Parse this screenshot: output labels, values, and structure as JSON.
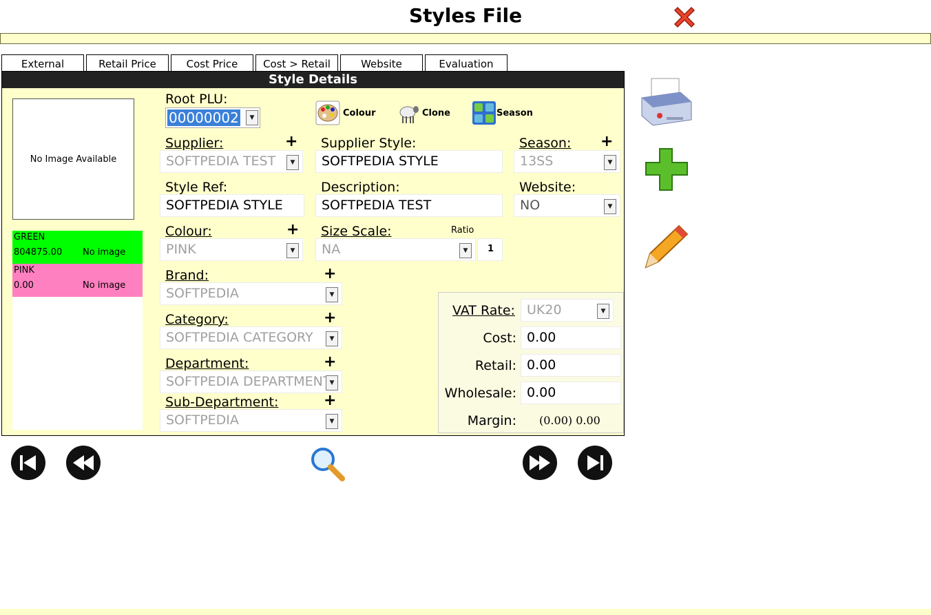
{
  "header": {
    "title": "Styles File"
  },
  "tabs": [
    {
      "label": "External"
    },
    {
      "label": "Retail Price"
    },
    {
      "label": "Cost Price"
    },
    {
      "label": "Cost > Retail"
    },
    {
      "label": "Website"
    },
    {
      "label": "Evaluation"
    }
  ],
  "panel": {
    "title": "Style Details"
  },
  "image_placeholder": "No Image Available",
  "colours": [
    {
      "name": "GREEN",
      "value": "804875.00",
      "image": "No image",
      "color": "#00ff00"
    },
    {
      "name": "PINK",
      "value": "0.00",
      "image": "No image",
      "color": "#ff80c0"
    }
  ],
  "root_plu": {
    "label": "Root PLU:",
    "value": "00000002"
  },
  "toolbar": {
    "colour_label": "Colour",
    "clone_label": "Clone",
    "season_label": "Season"
  },
  "form": {
    "supplier": {
      "label": "Supplier:",
      "value": "SOFTPEDIA TEST"
    },
    "supplier_style": {
      "label": "Supplier Style:",
      "value": "SOFTPEDIA STYLE"
    },
    "season": {
      "label": "Season:",
      "value": "13SS"
    },
    "style_ref": {
      "label": "Style Ref:",
      "value": "SOFTPEDIA STYLE"
    },
    "description": {
      "label": "Description:",
      "value": "SOFTPEDIA TEST"
    },
    "website": {
      "label": "Website:",
      "value": "NO"
    },
    "colour": {
      "label": "Colour:",
      "value": "PINK"
    },
    "size_scale": {
      "label": "Size Scale:",
      "value": "NA",
      "ratio_label": "Ratio",
      "ratio_value": "1"
    },
    "brand": {
      "label": "Brand:",
      "value": "SOFTPEDIA"
    },
    "category": {
      "label": "Category:",
      "value": "SOFTPEDIA CATEGORY"
    },
    "department": {
      "label": "Department:",
      "value": "SOFTPEDIA DEPARTMENT"
    },
    "sub_department": {
      "label": "Sub-Department:",
      "value": "SOFTPEDIA"
    }
  },
  "pricing": {
    "vat_label": "VAT Rate:",
    "vat_value": "UK20",
    "cost_label": "Cost:",
    "cost_value": "0.00",
    "retail_label": "Retail:",
    "retail_value": "0.00",
    "wholesale_label": "Wholesale:",
    "wholesale_value": "0.00",
    "margin_label": "Margin:",
    "margin_value": "(0.00) 0.00"
  },
  "icons": {
    "close": "close-x-icon",
    "print": "printer-icon",
    "add": "plus-icon",
    "edit": "pencil-icon",
    "search": "magnifier-icon",
    "first": "first-record-icon",
    "prev": "rewind-icon",
    "next": "fast-forward-icon",
    "last": "last-record-icon",
    "colour": "palette-icon",
    "clone": "sheep-icon",
    "season": "season-tiles-icon"
  },
  "colors": {
    "panel_bg": "#ffffcc",
    "header_bg": "#222222",
    "highlight": "#3a80d8"
  }
}
